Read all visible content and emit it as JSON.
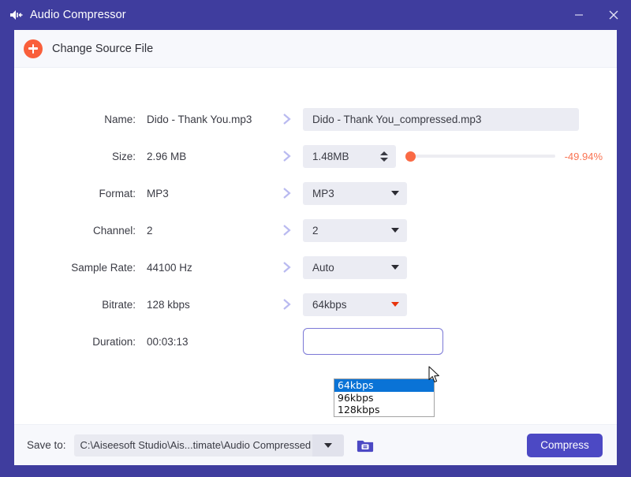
{
  "window": {
    "title": "Audio Compressor",
    "app_icon": "speaker-icon",
    "minimize_label": "–",
    "close_label": "✕"
  },
  "toolbar": {
    "change_source_label": "Change Source File",
    "plus_icon": "plus-circle-icon"
  },
  "form": {
    "rows": [
      {
        "label": "Name:",
        "source": "Dido - Thank You.mp3",
        "target": "Dido - Thank You_compressed.mp3"
      },
      {
        "label": "Size:",
        "source": "2.96 MB",
        "target": "1.48MB"
      },
      {
        "label": "Format:",
        "source": "MP3",
        "target": "MP3"
      },
      {
        "label": "Channel:",
        "source": "2",
        "target": "2"
      },
      {
        "label": "Sample Rate:",
        "source": "44100 Hz",
        "target": "Auto"
      },
      {
        "label": "Bitrate:",
        "source": "128 kbps",
        "target": "64kbps"
      },
      {
        "label": "Duration:",
        "source": "00:03:13",
        "target": ""
      }
    ],
    "size_percent": "-49.94%",
    "slider_position_percent": 0
  },
  "bitrate_dropdown": {
    "open": true,
    "options": [
      "64kbps",
      "96kbps",
      "128kbps"
    ],
    "selected_index": 0
  },
  "bottom": {
    "save_to_label": "Save to:",
    "path": "C:\\Aiseesoft Studio\\Ais...timate\\Audio Compressed",
    "folder_icon": "folder-icon",
    "compress_label": "Compress"
  },
  "colors": {
    "titlebar": "#3f3d9e",
    "accent_orange": "#f95f3b",
    "accent_purple": "#4c49c4",
    "highlight_blue": "#0a73d6",
    "field_grey": "#ebecf3"
  }
}
